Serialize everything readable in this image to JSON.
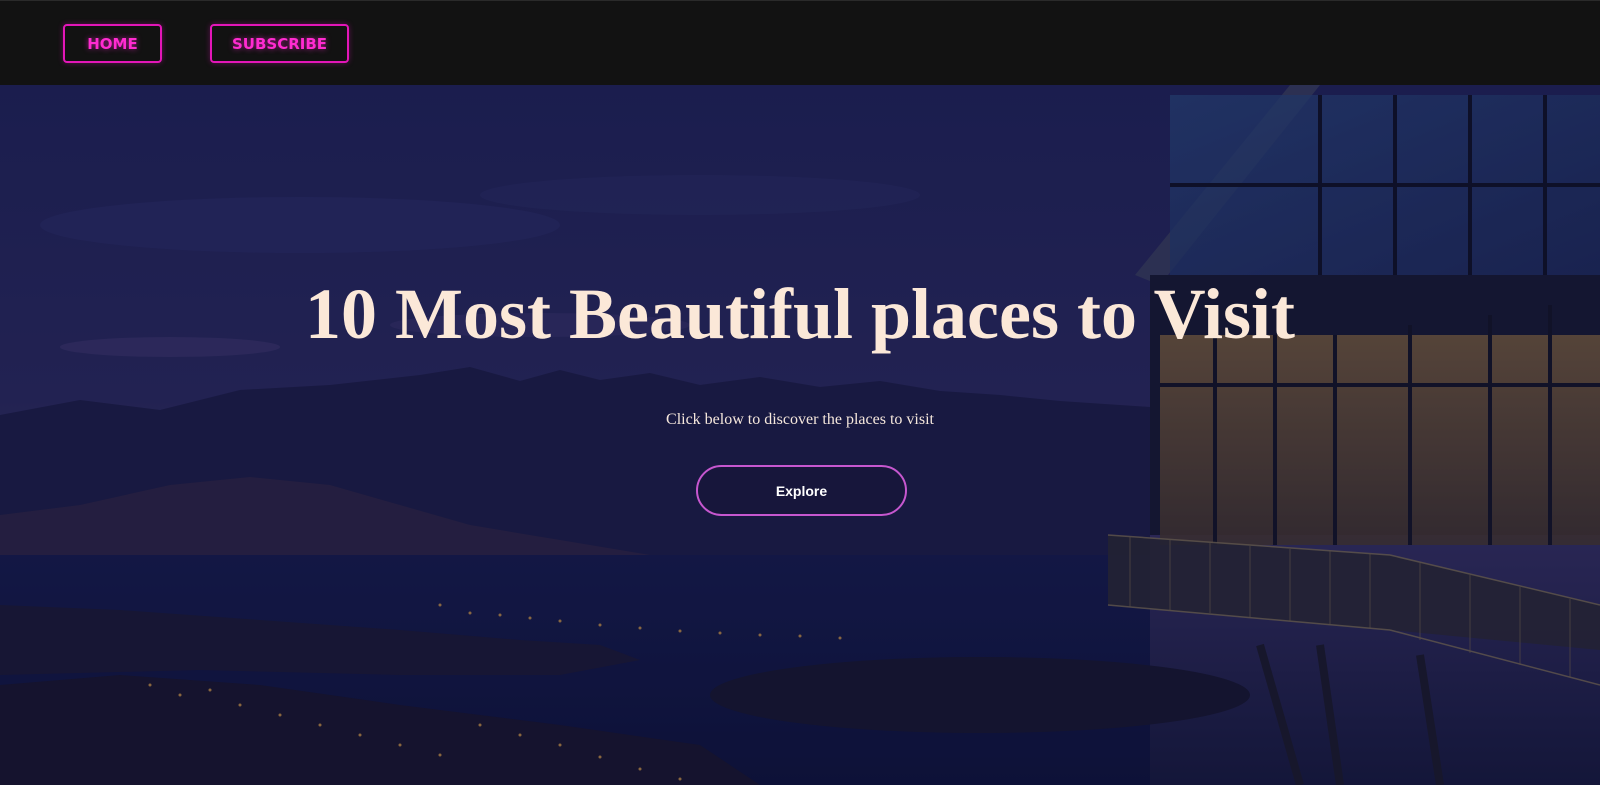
{
  "nav": {
    "home_label": "HOME",
    "subscribe_label": "SUBSCRIBE"
  },
  "hero": {
    "title": "10 Most Beautiful places to Visit",
    "subtitle": "Click below to discover the places to visit",
    "button_label": "Explore",
    "background_icon": "landscape-photo-icon"
  },
  "colors": {
    "nav_bar": "#121212",
    "nav_accent": "#e316b8",
    "title_text": "#fbe8d8",
    "button_border": "#c657cf",
    "overlay": "#14143c"
  }
}
